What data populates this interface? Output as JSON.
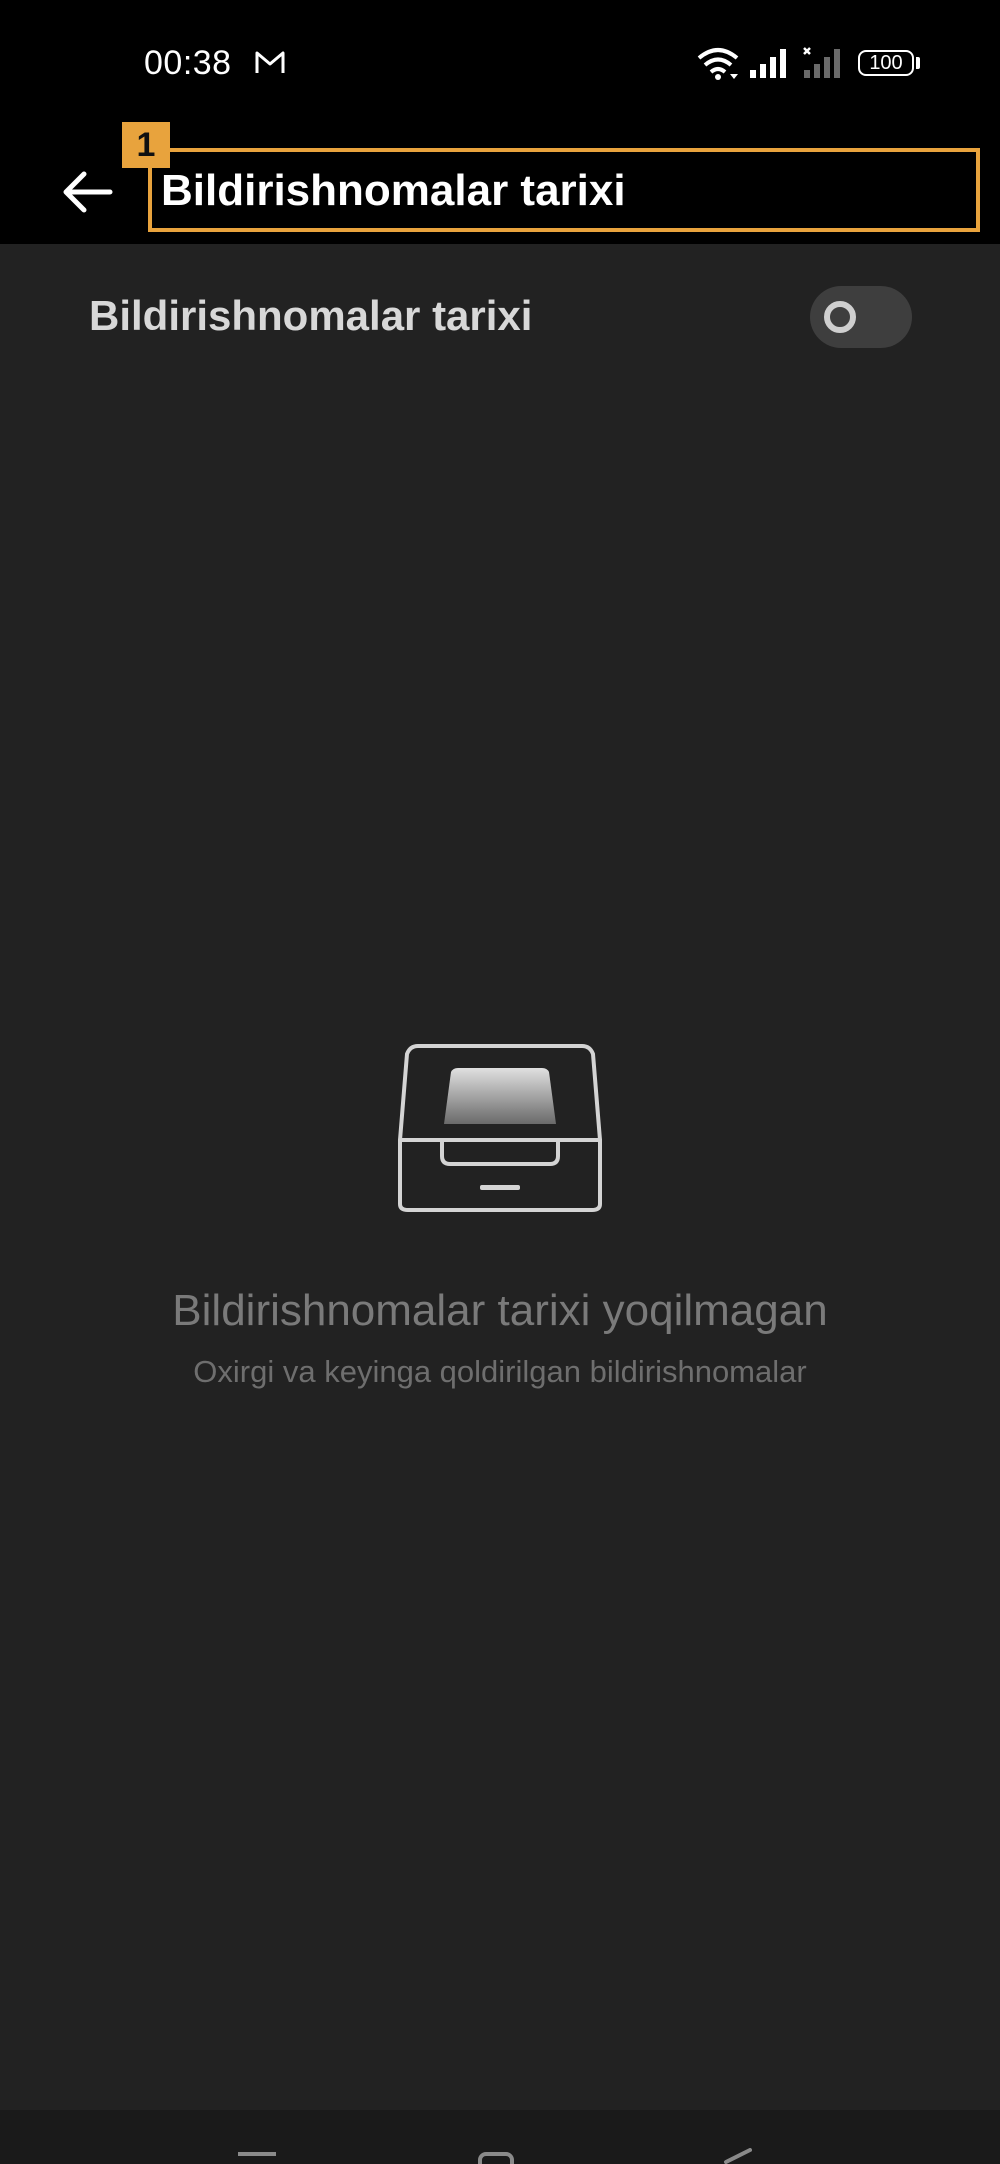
{
  "status_bar": {
    "time": "00:38",
    "battery": "100",
    "icons": [
      "gmail-icon",
      "wifi-icon",
      "signal-icon",
      "signal-no-service-icon",
      "battery-icon"
    ]
  },
  "app_bar": {
    "title": "Bildirishnomalar tarixi",
    "back_icon": "arrow-left-icon",
    "annotation_number": "1"
  },
  "settings": {
    "toggle_label": "Bildirishnomalar tarixi",
    "toggle_enabled": false
  },
  "empty_state": {
    "icon": "inbox-tray-icon",
    "title": "Bildirishnomalar tarixi yoqilmagan",
    "subtitle": "Oxirgi va keyinga qoldirilgan bildirishnomalar"
  },
  "colors": {
    "background": "#222222",
    "bar": "#000000",
    "highlight": "#e8a33d"
  }
}
